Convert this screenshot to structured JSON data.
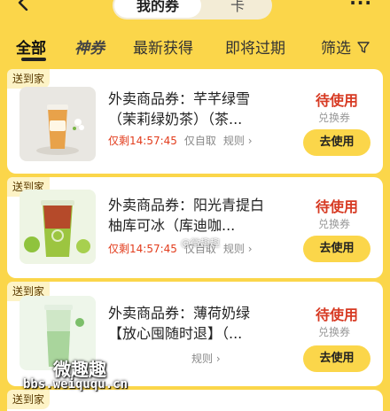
{
  "segment": {
    "active": "我的券",
    "inactive": "卡"
  },
  "tabs": [
    {
      "label": "全部"
    },
    {
      "label": "神券"
    },
    {
      "label": "最新获得"
    },
    {
      "label": "即将过期"
    },
    {
      "label": "筛选"
    }
  ],
  "cards": [
    {
      "badge": "送到家",
      "title": "外卖商品券：芊芊绿雪（茉莉绿奶茶）（茶...",
      "remain": "仅剩14:57:45",
      "extra": "仅自取",
      "rule": "规则 ›",
      "status": "待使用",
      "type": "兑换券",
      "button": "去使用"
    },
    {
      "badge": "送到家",
      "title": "外卖商品券：阳光青提白柚库可冰（库迪咖...",
      "remain": "仅剩14:57:45",
      "extra": "仅自取",
      "rule": "规则 ›",
      "status": "待使用",
      "type": "兑换券",
      "button": "去使用"
    },
    {
      "badge": "送到家",
      "title": "外卖商品券：薄荷奶绿【放心囤随时退】（...",
      "remain": "",
      "extra": "",
      "rule": "规则 ›",
      "status": "待使用",
      "type": "兑换券",
      "button": "去使用"
    },
    {
      "badge": "送到家"
    }
  ],
  "watermark": {
    "top": "微趣趣",
    "url": "bbs.weiququ.cn",
    "center": "@微趣趣"
  },
  "colors": {
    "brand_yellow": "#fbd64a",
    "status_red": "#d73a23",
    "remain_red": "#e23c1c"
  },
  "icons": {
    "back": "chevron-left-icon",
    "more": "more-dots-icon",
    "filter": "filter-funnel-icon"
  }
}
